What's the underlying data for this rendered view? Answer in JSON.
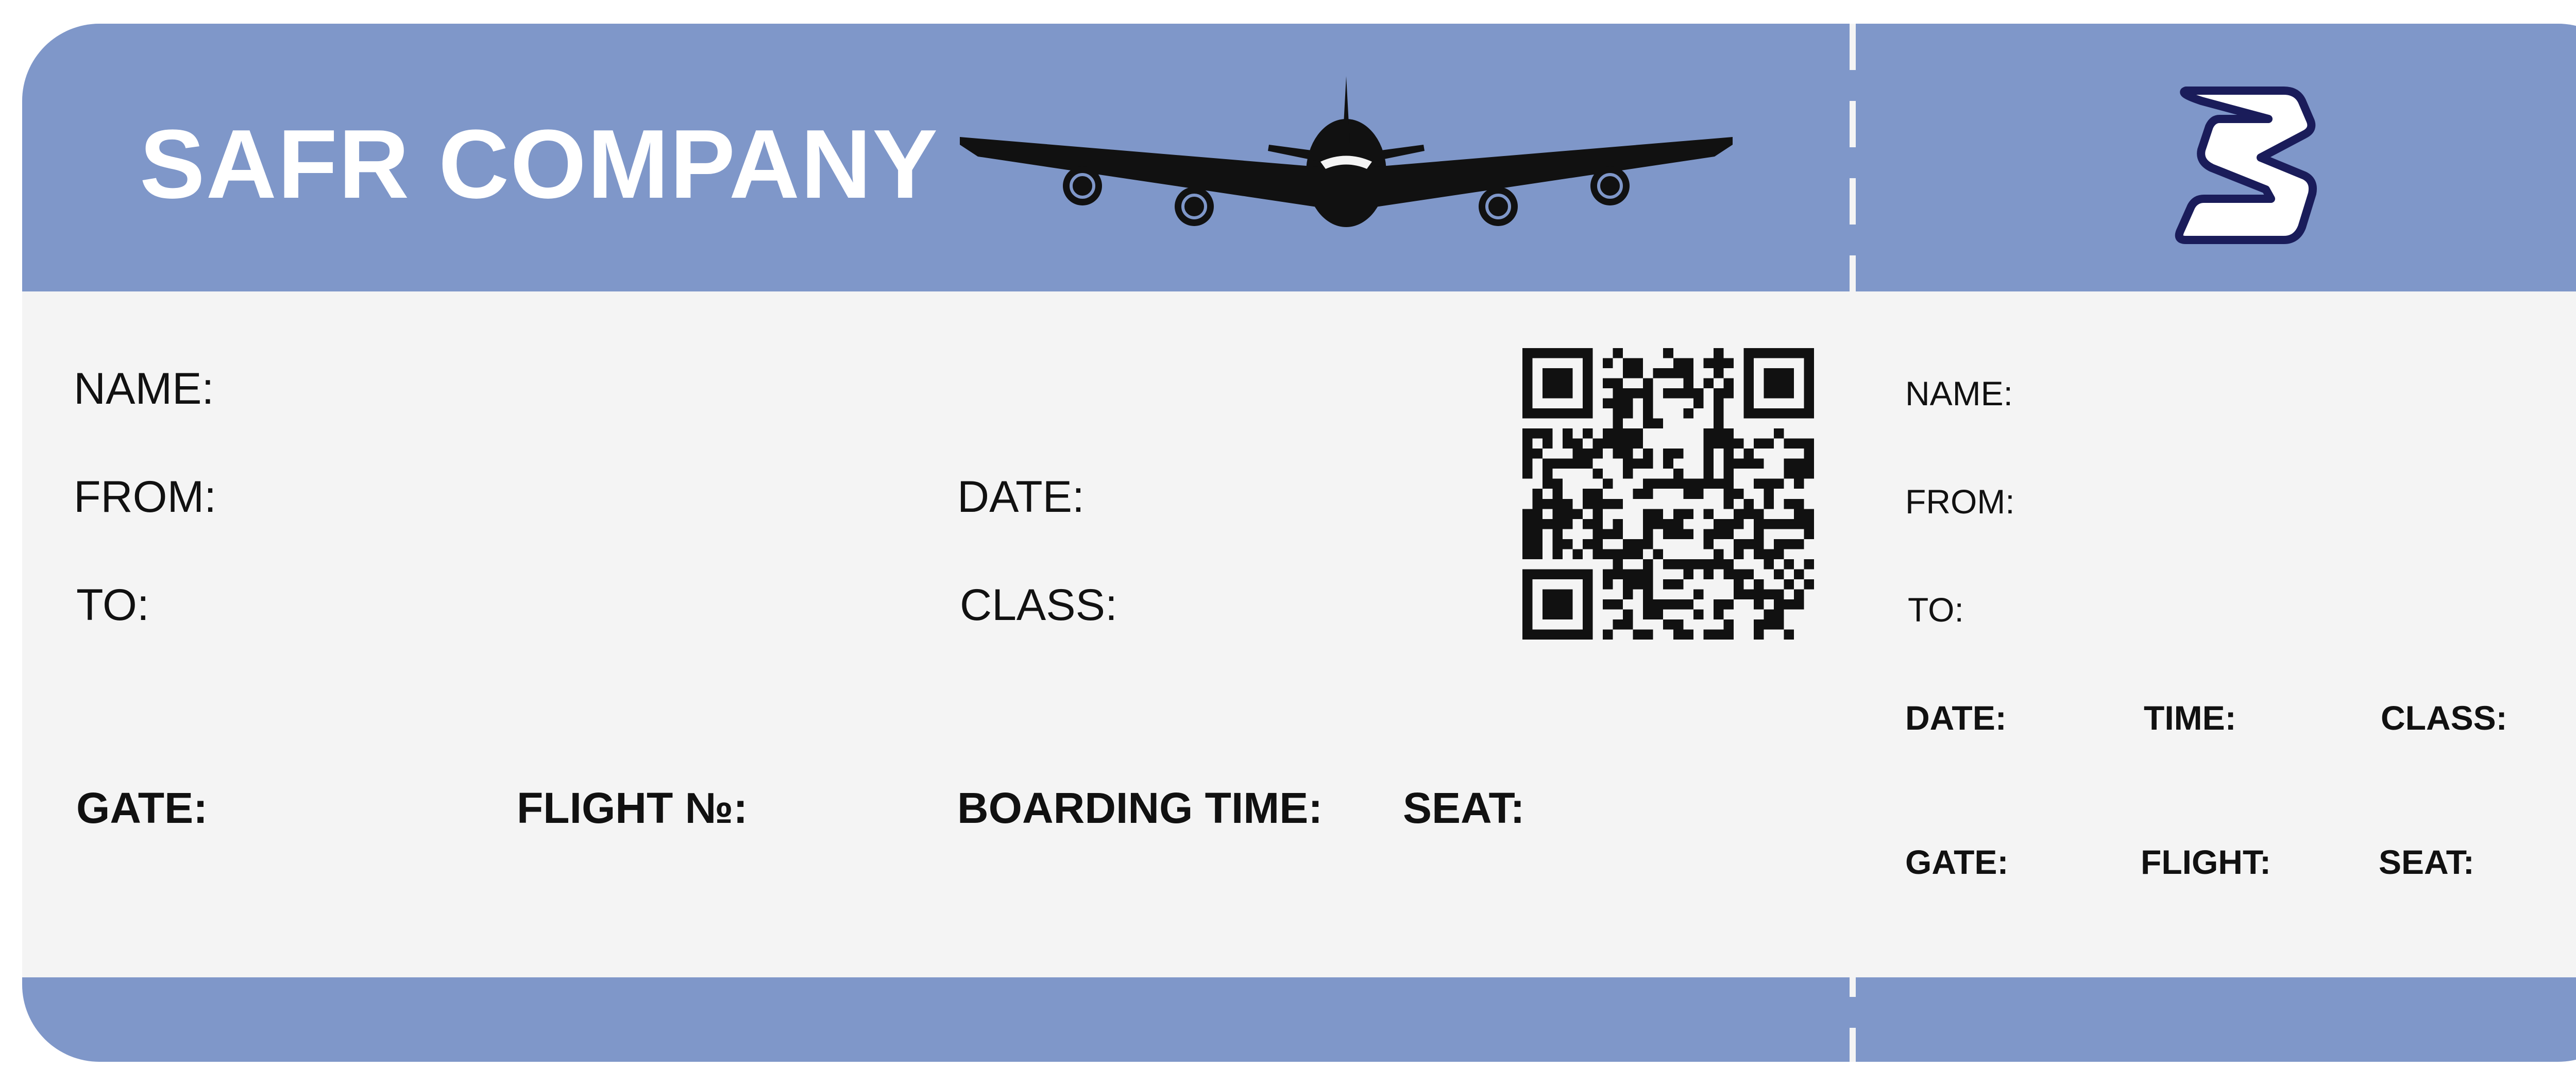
{
  "ticket": {
    "company_name": "SAFR COMPANY",
    "main": {
      "name_label": "NAME:",
      "from_label": "FROM:",
      "to_label": "TO:",
      "date_label": "DATE:",
      "class_label": "CLASS:",
      "gate_label": "GATE:",
      "flight_label": "FLIGHT №:",
      "boarding_time_label": "BOARDING TIME:",
      "seat_label": "SEAT:"
    },
    "stub": {
      "name_label": "NAME:",
      "from_label": "FROM:",
      "to_label": "TO:",
      "date_label": "DATE:",
      "time_label": "TIME:",
      "class_label": "CLASS:",
      "gate_label": "GATE:",
      "flight_label": "FLIGHT:",
      "seat_label": "SEAT:"
    },
    "icons": {
      "airplane": "airplane-icon",
      "logo": "s-logo-icon",
      "qr": "qr-code"
    },
    "colors": {
      "band": "#7f97c9",
      "body": "#f4f4f4",
      "text": "#111111"
    }
  }
}
